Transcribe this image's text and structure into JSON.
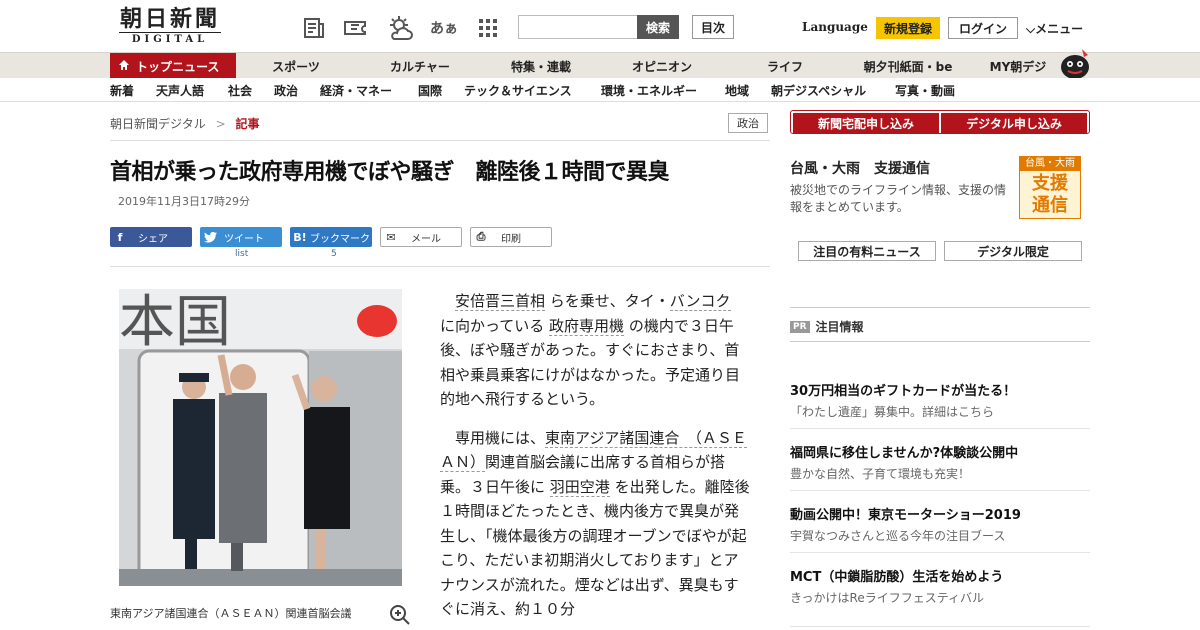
{
  "header": {
    "logo_jp": "朝日新聞",
    "logo_en": "DIGITAL",
    "search_button": "検索",
    "toc_button": "目次",
    "language": "Language",
    "register": "新規登録",
    "login": "ログイン",
    "menu": "メニュー",
    "font_size_label": "あぁ"
  },
  "nav_primary": [
    "トップニュース",
    "スポーツ",
    "カルチャー",
    "特集・連載",
    "オピニオン",
    "ライフ",
    "朝夕刊紙面・be",
    "MY朝デジ"
  ],
  "nav_secondary": [
    "新着",
    "天声人語",
    "社会",
    "政治",
    "経済・マネー",
    "国際",
    "テック＆サイエンス",
    "環境・エネルギー",
    "地域",
    "朝デジスペシャル",
    "写真・動画"
  ],
  "breadcrumb": {
    "home": "朝日新聞デジタル",
    "sep": ">",
    "current": "記事"
  },
  "category": "政治",
  "article": {
    "headline": "首相が乗った政府専用機でぼや騒ぎ　離陸後１時間で異臭",
    "date": "2019年11月3日17時29分",
    "paragraphs": [
      [
        "",
        "安倍晋三首相",
        " らを乗せ、タイ・",
        "バンコク",
        " に向かっている ",
        "政府専用機",
        " の機内で３日午後、ぼや騒ぎがあった。すぐにおさまり、首相や乗員乗客にけがはなかった。予定通り目的地へ飛行するという。"
      ],
      [
        "専用機には、",
        "東南アジア諸国連合　（ＡＳＥＡＮ）",
        "関連首脳会議に出席する首相らが搭乗。３日午後に ",
        "羽田空港",
        " を出発した。離陸後１時間ほどたったとき、機内後方で異臭が発生し、「機体最後方の調理オーブンでぼやが起こり、ただいま初期消火しております」とアナウンスが流れた。煙などは出ず、異臭もすぐに消え、約１０分"
      ]
    ],
    "caption": "東南アジア諸国連合（ＡＳＥＡＮ）関連首脳会議"
  },
  "share": {
    "facebook": "シェア",
    "twitter": "ツイート",
    "twitter_count": "list",
    "hatena": "ブックマーク",
    "hatena_count": "5",
    "mail": "メール",
    "print": "印刷"
  },
  "sidebar": {
    "sub_home": "新聞宅配申し込み",
    "sub_digital": "デジタル申し込み",
    "typhoon_title": "台風・大雨　支援通信",
    "typhoon_text": "被災地でのライフライン情報、支援の情報をまとめています。",
    "badge_top": "台風・大雨",
    "badge_main": "支援通信",
    "tab_paid": "注目の有料ニュース",
    "tab_digital": "デジタル限定",
    "pr_tag": "PR",
    "pr_label": "注目情報",
    "ads": [
      {
        "title": "30万円相当のギフトカードが当たる！",
        "sub": "「わたし遺産」募集中。詳細はこちら"
      },
      {
        "title": "福岡県に移住しませんか?体験談公開中",
        "sub": "豊かな自然、子育て環境も充実！"
      },
      {
        "title": "動画公開中！東京モーターショー2019",
        "sub": "宇賀なつみさんと巡る今年の注目ブース"
      },
      {
        "title": "MCT（中鎖脂肪酸）生活を始めよう",
        "sub": "きっかけはReライフフェスティバル"
      }
    ]
  },
  "photo": {
    "sign_text": "本国"
  },
  "colors": {
    "brand_red": "#b3141c",
    "register_yellow": "#f6c400"
  }
}
